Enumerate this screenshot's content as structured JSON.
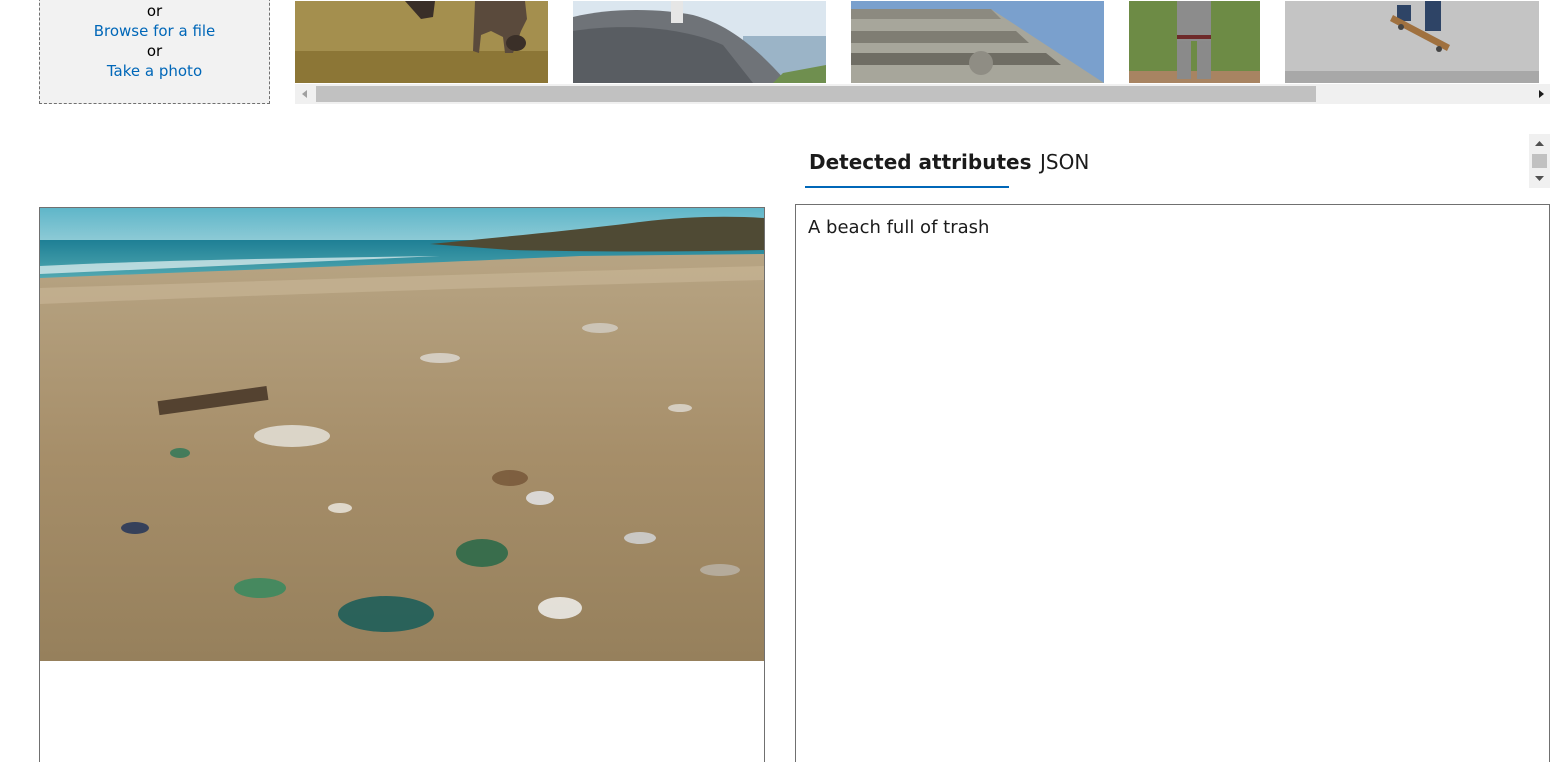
{
  "upload": {
    "or_top": "or",
    "browse_label": "Browse for a file",
    "or_mid": "or",
    "photo_label": "Take a photo"
  },
  "thumbnails": [
    {
      "name": "cattle-grazing-thumbnail"
    },
    {
      "name": "rocky-coast-thumbnail"
    },
    {
      "name": "building-facade-thumbnail"
    },
    {
      "name": "baseball-player-thumbnail"
    },
    {
      "name": "skateboarder-thumbnail"
    }
  ],
  "tabs": {
    "detected_label": "Detected attributes",
    "json_label": "JSON"
  },
  "result": {
    "caption": "A beach full of trash"
  },
  "colors": {
    "link": "#0067b8",
    "tab_underline": "#0067b8",
    "border": "#707070",
    "scroll_track": "#f0f0f0",
    "scroll_thumb": "#c1c1c1"
  }
}
